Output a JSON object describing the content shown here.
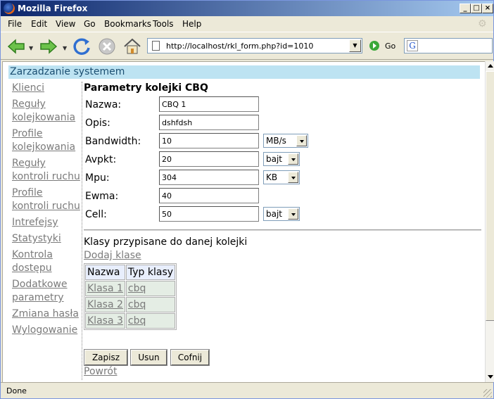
{
  "window": {
    "title": "Mozilla Firefox",
    "minimize": "_",
    "maximize": "□",
    "close": "×"
  },
  "menu": {
    "items": [
      "File",
      "Edit",
      "View",
      "Go",
      "Bookmarks",
      "Tools",
      "Help"
    ]
  },
  "toolbar": {
    "url": "http://localhost/rkl_form.php?id=1010",
    "go_label": "Go",
    "search_icon_glyph": "G"
  },
  "page": {
    "header": "Zarzadzanie systemem",
    "sidebar": [
      "Klienci",
      "Reguły kolejkowania",
      "Profile kolejkowania",
      "Reguły kontroli ruchu",
      "Profile kontroli ruchu",
      "Intrefejsy",
      "Statystyki",
      "Kontrola dostępu",
      "Dodatkowe parametry",
      "Zmiana hasła",
      "Wylogowanie"
    ],
    "form_title": "Parametry kolejki CBQ",
    "fields": {
      "nazwa": {
        "label": "Nazwa:",
        "value": "CBQ 1"
      },
      "opis": {
        "label": "Opis:",
        "value": "dshfdsh"
      },
      "bandwidth": {
        "label": "Bandwidth:",
        "value": "10",
        "unit": "MB/s"
      },
      "avpkt": {
        "label": "Avpkt:",
        "value": "20",
        "unit": "bajt"
      },
      "mpu": {
        "label": "Mpu:",
        "value": "304",
        "unit": "KB"
      },
      "ewma": {
        "label": "Ewma:",
        "value": "40"
      },
      "cell": {
        "label": "Cell:",
        "value": "50",
        "unit": "bajt"
      }
    },
    "classes_title": "Klasy przypisane do danej kolejki",
    "add_class": "Dodaj klase",
    "table": {
      "headers": [
        "Nazwa",
        "Typ klasy"
      ],
      "rows": [
        [
          "Klasa 1",
          "cbq"
        ],
        [
          "Klasa 2",
          "cbq"
        ],
        [
          "Klasa 3",
          "cbq"
        ]
      ]
    },
    "buttons": {
      "save": "Zapisz",
      "delete": "Usun",
      "undo": "Cofnij"
    },
    "back": "Powrót"
  },
  "status": "Done",
  "colors": {
    "header_bg": "#bde3f2",
    "link": "#7b7b7b",
    "table_header_bg": "#e8eefc",
    "table_cell_bg": "#e4ede4"
  }
}
